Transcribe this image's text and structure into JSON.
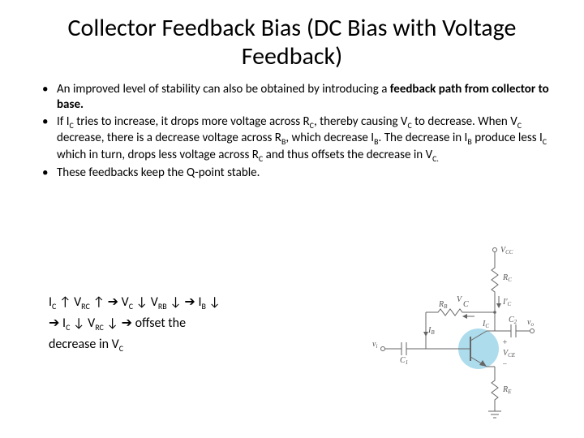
{
  "title": "Collector Feedback Bias (DC Bias with Voltage Feedback)",
  "bullets": {
    "b1_pre": "An improved level of stability can also be obtained by introducing a ",
    "b1_bold": "feedback path from collector to base.",
    "b2": "If I",
    "b2_sub1": "C",
    "b2_mid1": " tries to increase, it drops more voltage across R",
    "b2_sub2": "C",
    "b2_mid2": ", thereby causing V",
    "b2_sub3": "C",
    "b2_mid3": " to decrease. When V",
    "b2_sub4": "C",
    "b2_mid4": " decrease, there is a decrease voltage across R",
    "b2_sub5": "B",
    "b2_mid5": ", which decrease I",
    "b2_sub6": "B",
    "b2_mid6": ". The decrease in I",
    "b2_sub7": "B",
    "b2_mid7": " produce less I",
    "b2_sub8": "C",
    "b2_mid8": " which in turn, drops less voltage across R",
    "b2_sub9": "C",
    "b2_mid9": " and thus offsets the decrease in V",
    "b2_sub10": "C.",
    "b3": "These feedbacks keep the Q-point stable."
  },
  "sequence": {
    "line1_parts": [
      "I",
      "C",
      " ↑ V",
      "RC",
      " ↑ ➔ V",
      "C",
      " ↓ V",
      "RB",
      " ↓ ➔ I",
      "B",
      " ↓"
    ],
    "line2_parts": [
      "➔ I",
      "C",
      " ↓ V",
      "RC",
      " ↓ ➔  offset the"
    ],
    "line3_parts": [
      "decrease in V",
      "C"
    ]
  },
  "circuit": {
    "vcc": "V_CC",
    "rc": "R_C",
    "rb": "R_B",
    "re": "R_E",
    "c1": "C_1",
    "c2": "C_2",
    "ic": "I_C",
    "ib": "I_B",
    "ic2": "I_C'",
    "vce": "V_CE",
    "vi": "v_i",
    "vo": "v_o",
    "vc_node": "V",
    "vc_sub": "C"
  }
}
